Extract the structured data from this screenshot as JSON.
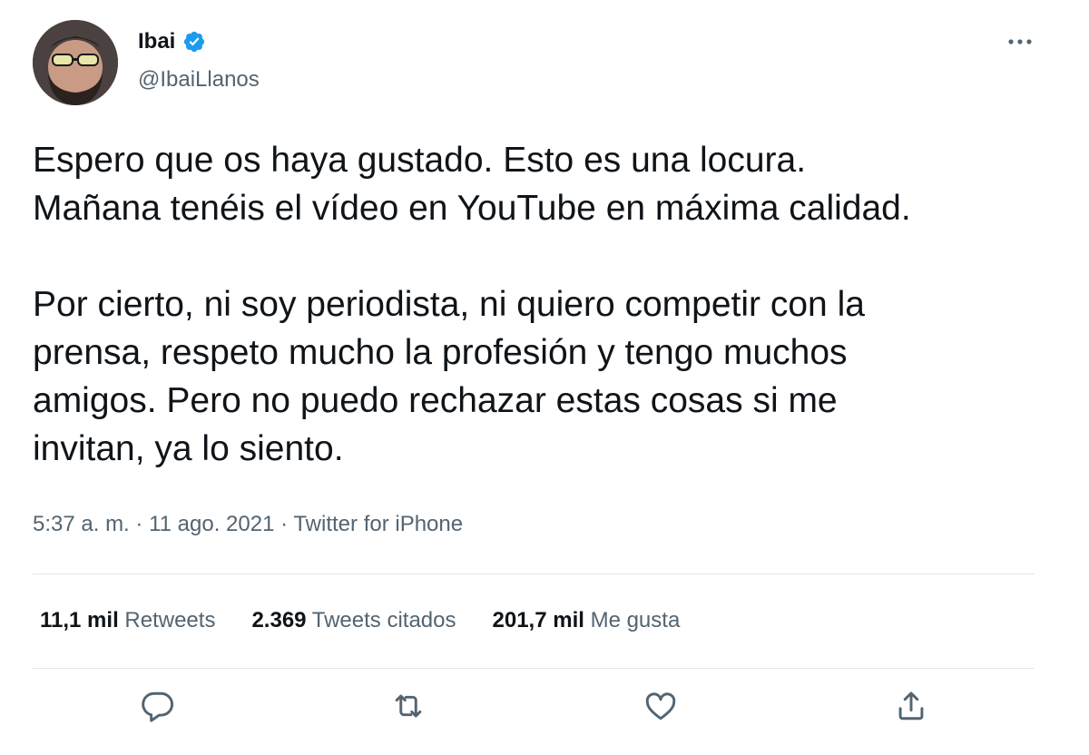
{
  "user": {
    "display_name": "Ibai",
    "handle": "@IbaiLlanos",
    "verified": true
  },
  "tweet": {
    "lines_paragraph_1": [
      "Espero que os haya gustado. Esto es una locura.",
      "Mañana tenéis el vídeo en YouTube en máxima calidad."
    ],
    "lines_paragraph_2": [
      "Por cierto, ni soy periodista, ni quiero competir con la",
      "prensa, respeto mucho la profesión y tengo muchos",
      "amigos. Pero no puedo rechazar estas cosas si me",
      "invitan, ya lo siento."
    ],
    "time": "5:37 a. m.",
    "date": "11 ago. 2021",
    "source": "Twitter for iPhone",
    "separator": "·"
  },
  "stats": [
    {
      "count": "11,1 mil",
      "label": "Retweets"
    },
    {
      "count": "2.369",
      "label": "Tweets citados"
    },
    {
      "count": "201,7 mil",
      "label": "Me gusta"
    }
  ],
  "icons": {
    "more": "more-horizontal-icon",
    "reply": "reply-icon",
    "retweet": "retweet-icon",
    "like": "heart-icon",
    "share": "share-icon",
    "verified": "verified-badge-icon"
  },
  "colors": {
    "text_primary": "#0f1419",
    "text_secondary": "#536471",
    "verified_blue": "#1d9bf0",
    "divider": "#e1e6ea"
  }
}
